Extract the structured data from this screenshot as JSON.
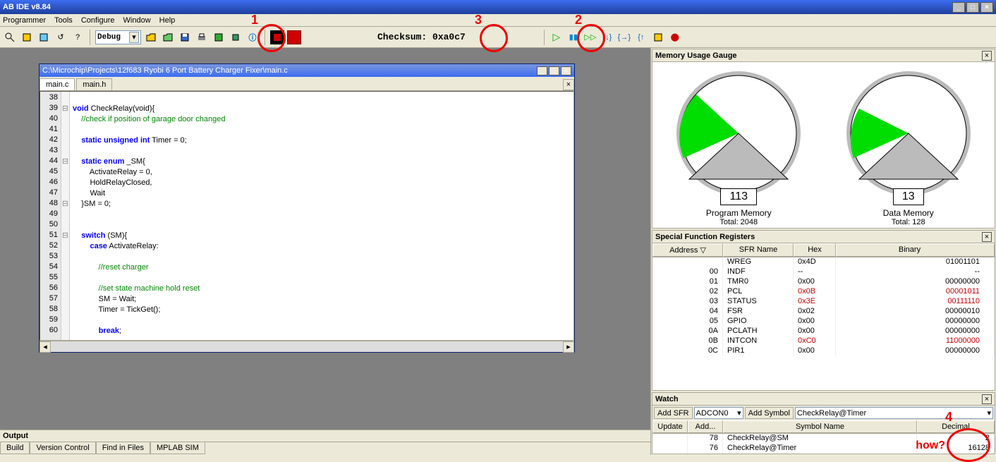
{
  "app_title": "AB IDE v8.84",
  "menus": [
    "Programmer",
    "Tools",
    "Configure",
    "Window",
    "Help"
  ],
  "toolbar": {
    "config_label": "Debug",
    "checksum_label": "Checksum:  0xa0c7"
  },
  "annotations": {
    "a1": "1",
    "a2": "2",
    "a3": "3",
    "a4": "4",
    "how": "how?"
  },
  "codewin": {
    "title": "C:\\Microchip\\Projects\\12f683 Ryobi 6 Port Battery Charger Fixer\\main.c",
    "tabs": [
      "main.c",
      "main.h"
    ],
    "lines": [
      {
        "n": "38",
        "t": ""
      },
      {
        "n": "39",
        "t": "void CheckRelay(void){",
        "kw": [
          "void",
          "void"
        ],
        "fold": "-"
      },
      {
        "n": "40",
        "t": "    //check if position of garage door changed",
        "cmt": true
      },
      {
        "n": "41",
        "t": ""
      },
      {
        "n": "42",
        "t": "    static unsigned int Timer = 0;",
        "kw": [
          "static",
          "unsigned",
          "int"
        ]
      },
      {
        "n": "43",
        "t": ""
      },
      {
        "n": "44",
        "t": "    static enum _SM{",
        "kw": [
          "static",
          "enum"
        ],
        "fold": "-"
      },
      {
        "n": "45",
        "t": "        ActivateRelay = 0,"
      },
      {
        "n": "46",
        "t": "        HoldRelayClosed,"
      },
      {
        "n": "47",
        "t": "        Wait"
      },
      {
        "n": "48",
        "t": "    }SM = 0;",
        "fold": "-"
      },
      {
        "n": "49",
        "t": ""
      },
      {
        "n": "50",
        "t": ""
      },
      {
        "n": "51",
        "t": "    switch (SM){",
        "kw": [
          "switch"
        ],
        "fold": "-",
        "bp": true
      },
      {
        "n": "52",
        "t": "        case ActivateRelay:",
        "kw": [
          "case"
        ]
      },
      {
        "n": "53",
        "t": ""
      },
      {
        "n": "54",
        "t": "            //reset charger",
        "cmt": true
      },
      {
        "n": "55",
        "t": ""
      },
      {
        "n": "56",
        "t": "            //set state machine hold reset",
        "cmt": true
      },
      {
        "n": "57",
        "t": "            SM = Wait;"
      },
      {
        "n": "58",
        "t": "            Timer = TickGet();"
      },
      {
        "n": "59",
        "t": ""
      },
      {
        "n": "60",
        "t": "            break;",
        "kw": [
          "break"
        ]
      }
    ]
  },
  "gauge_panel": {
    "title": "Memory Usage Gauge",
    "program": {
      "value": "113",
      "label": "Program Memory",
      "total": "Total: 2048"
    },
    "data": {
      "value": "13",
      "label": "Data Memory",
      "total": "Total: 128"
    }
  },
  "sfr_panel": {
    "title": "Special Function Registers",
    "headers": [
      "Address ▽",
      "SFR Name",
      "Hex",
      "Binary"
    ],
    "rows": [
      {
        "addr": "",
        "name": "WREG",
        "hex": "0x4D",
        "bin": "01001101",
        "sel": true
      },
      {
        "addr": "00",
        "name": "INDF",
        "hex": "--",
        "bin": "--"
      },
      {
        "addr": "01",
        "name": "TMR0",
        "hex": "0x00",
        "bin": "00000000"
      },
      {
        "addr": "02",
        "name": "PCL",
        "hex": "0x0B",
        "bin": "00001011",
        "red": true
      },
      {
        "addr": "03",
        "name": "STATUS",
        "hex": "0x3E",
        "bin": "00111110",
        "red": true
      },
      {
        "addr": "04",
        "name": "FSR",
        "hex": "0x02",
        "bin": "00000010"
      },
      {
        "addr": "05",
        "name": "GPIO",
        "hex": "0x00",
        "bin": "00000000"
      },
      {
        "addr": "0A",
        "name": "PCLATH",
        "hex": "0x00",
        "bin": "00000000"
      },
      {
        "addr": "0B",
        "name": "INTCON",
        "hex": "0xC0",
        "bin": "11000000",
        "red": true
      },
      {
        "addr": "0C",
        "name": "PIR1",
        "hex": "0x00",
        "bin": "00000000"
      }
    ]
  },
  "watch_panel": {
    "title": "Watch",
    "add_sfr": "Add SFR",
    "sfr_combo": "ADCON0",
    "add_symbol": "Add Symbol",
    "sym_combo": "CheckRelay@Timer",
    "headers": [
      "Update",
      "Add...",
      "Symbol Name",
      "Decimal"
    ],
    "rows": [
      {
        "update": "",
        "addr": "78",
        "name": "CheckRelay@SM",
        "dec": "2"
      },
      {
        "update": "",
        "addr": "76",
        "name": "CheckRelay@Timer",
        "dec": "16128"
      }
    ]
  },
  "output": {
    "title": "Output",
    "tabs": [
      "Build",
      "Version Control",
      "Find in Files",
      "MPLAB SIM"
    ]
  },
  "chart_data": [
    {
      "type": "gauge",
      "title": "Program Memory",
      "value": 113,
      "max": 2048
    },
    {
      "type": "gauge",
      "title": "Data Memory",
      "value": 13,
      "max": 128
    }
  ]
}
